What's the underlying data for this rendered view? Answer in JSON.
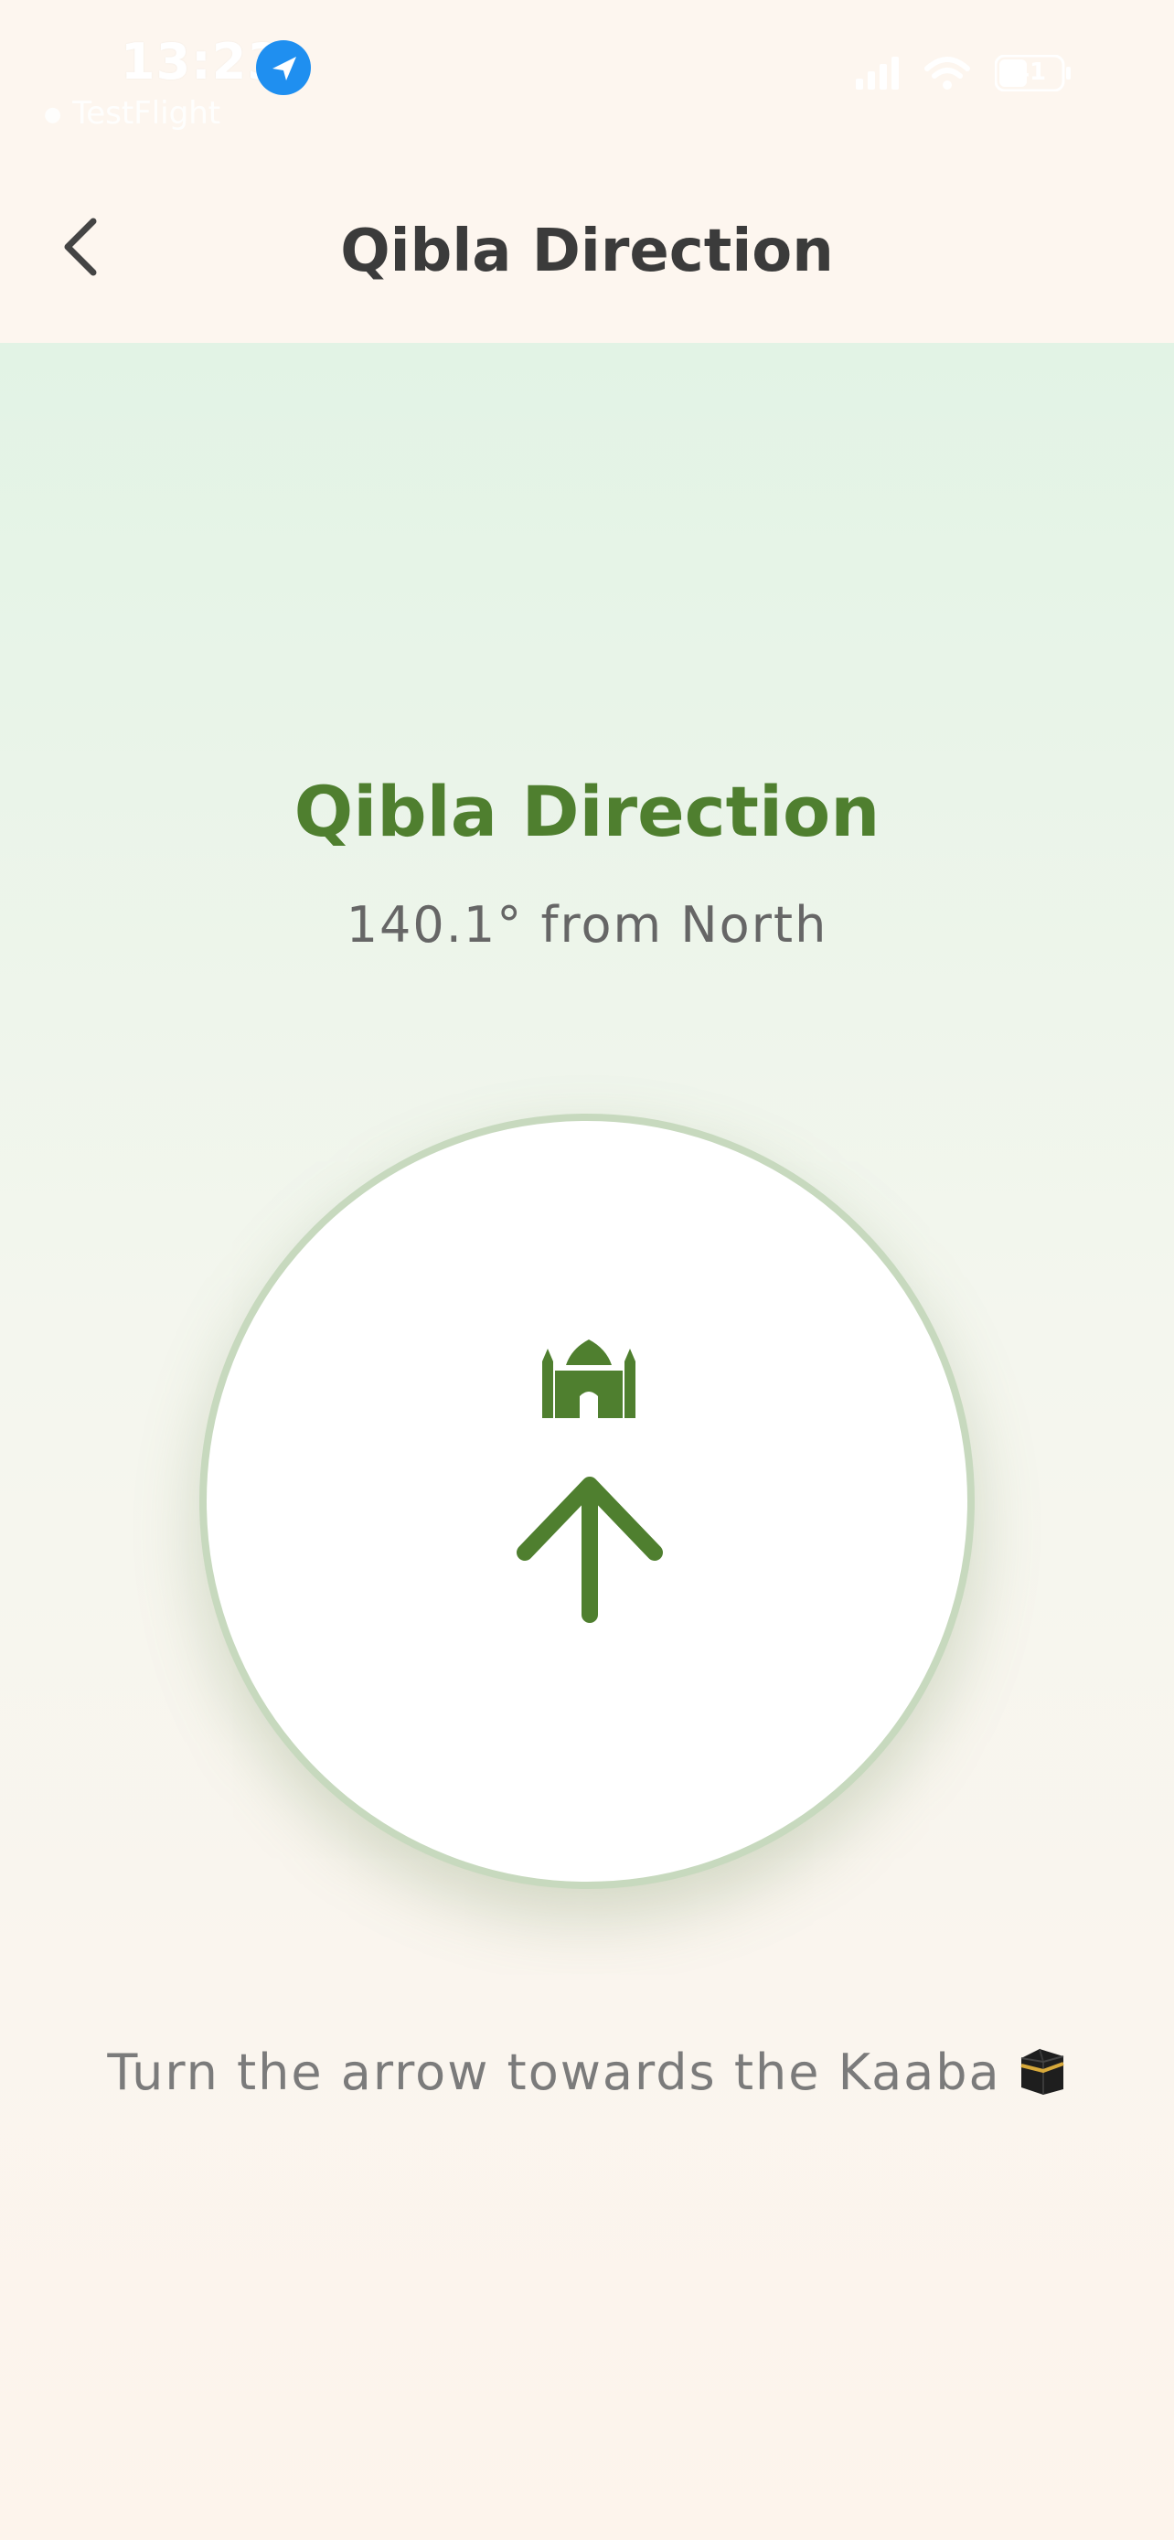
{
  "status_bar": {
    "time": "13:23",
    "app_name": "TestFlight",
    "battery": "41"
  },
  "nav": {
    "title": "Qibla Direction"
  },
  "main": {
    "heading": "Qibla Direction",
    "degree_text": "140.1° from North",
    "hint": "Turn the arrow towards the Kaaba"
  },
  "colors": {
    "accent": "#4f7f2f",
    "ring": "#c7d9be",
    "location_icon": "#1f8ff0"
  },
  "icons": [
    "back-chevron-icon",
    "mosque-icon",
    "arrow-up-icon",
    "kaaba-icon",
    "location-arrow-icon",
    "signal-icon",
    "wifi-icon",
    "battery-icon"
  ]
}
